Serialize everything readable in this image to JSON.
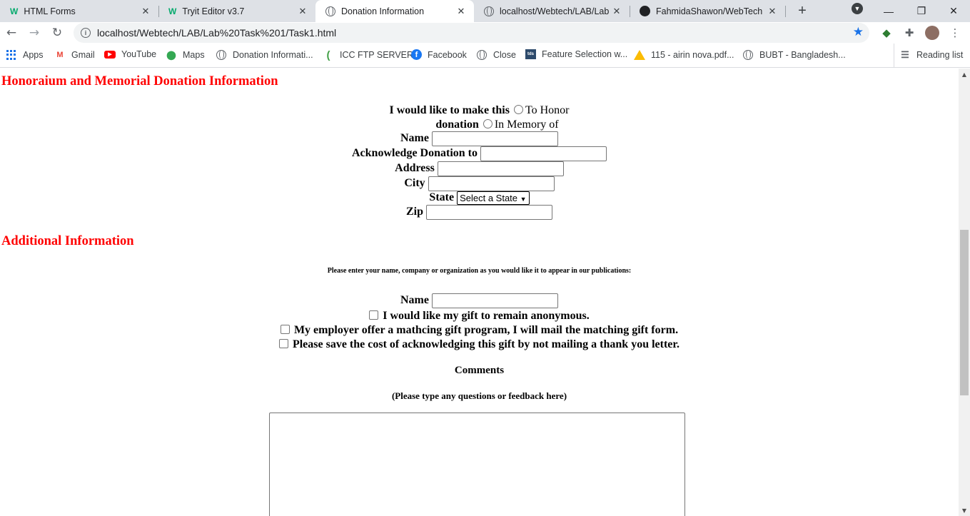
{
  "tabs": [
    {
      "title": "HTML Forms",
      "favicon": "w3schools-icon",
      "active": false
    },
    {
      "title": "Tryit Editor v3.7",
      "favicon": "w3schools-icon",
      "active": false
    },
    {
      "title": "Donation Information",
      "favicon": "globe-icon",
      "active": true
    },
    {
      "title": "localhost/Webtech/LAB/Lab",
      "favicon": "globe-icon",
      "active": false
    },
    {
      "title": "FahmidaShawon/WebTech",
      "favicon": "github-icon",
      "active": false
    }
  ],
  "tab_favicon_letter": "W",
  "tab_close_glyph": "✕",
  "new_tab_glyph": "+",
  "toolbar": {
    "url": "localhost/Webtech/LAB/Lab%20Task%201/Task1.html",
    "info_glyph": "i"
  },
  "bookmarks": [
    {
      "label": "Apps",
      "icon": "apps-grid-icon"
    },
    {
      "label": "Gmail",
      "icon": "gmail-icon",
      "glyph": "M"
    },
    {
      "label": "YouTube",
      "icon": "youtube-icon",
      "glyph": "▶"
    },
    {
      "label": "Maps",
      "icon": "maps-pin-icon",
      "glyph": "📍"
    },
    {
      "label": "Donation Informati...",
      "icon": "globe-icon"
    },
    {
      "label": "ICC FTP SERVER",
      "icon": "icc-icon",
      "glyph": "("
    },
    {
      "label": "Facebook",
      "icon": "facebook-icon",
      "glyph": "f"
    },
    {
      "label": "Close",
      "icon": "globe-icon"
    },
    {
      "label": "Feature Selection w...",
      "icon": "tds-icon",
      "glyph": "tds"
    },
    {
      "label": "115 - airin nova.pdf...",
      "icon": "google-drive-icon"
    },
    {
      "label": "BUBT - Bangladesh...",
      "icon": "globe-icon"
    }
  ],
  "reading_list": "Reading list",
  "page": {
    "section1_heading": "Honoraium and Memorial Donation Information",
    "make_this_label": "I would like to make this",
    "donation_label": "donation",
    "radio_honor": "To Honor",
    "radio_memory": "In Memory of",
    "name_label": "Name",
    "acknowledge_label": "Acknowledge Donation to",
    "address_label": "Address",
    "city_label": "City",
    "state_label": "State",
    "state_selected": "Select a State",
    "zip_label": "Zip",
    "section2_heading": "Additional Information",
    "publication_note": "Please enter your name, company or organization as you would like it to appear in our publications:",
    "name2_label": "Name",
    "check_anonymous": "I would like my gift to remain anonymous.",
    "check_employer": "My employer offer a mathcing gift program, I will mail the matching gift form.",
    "check_save_cost": "Please save the cost of acknowledging this gift by not mailing a thank you letter.",
    "comments_heading": "Comments",
    "comments_hint": "(Please type any questions or feedback here)"
  }
}
